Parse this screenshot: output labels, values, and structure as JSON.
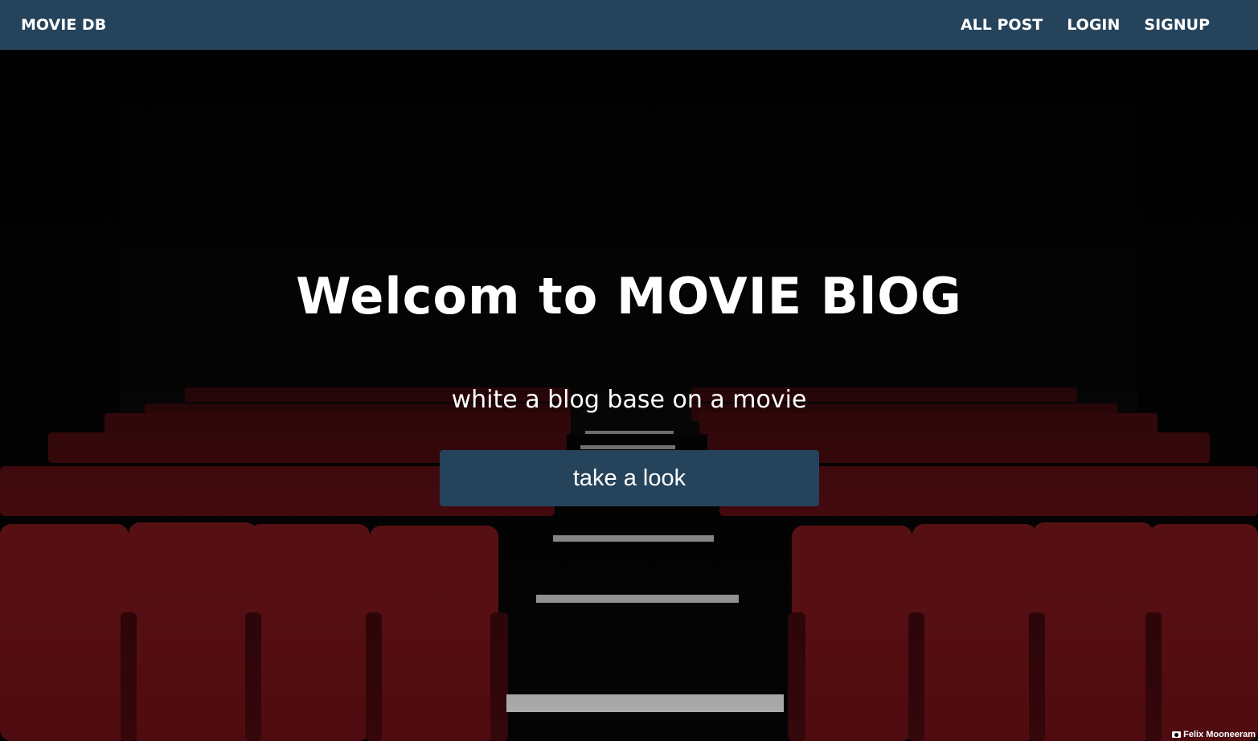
{
  "navbar": {
    "brand": "MOVIE DB",
    "links": [
      "ALL POST",
      "LOGIN",
      "SIGNUP"
    ]
  },
  "hero": {
    "title": "Welcom to MOVIE BlOG",
    "subtitle": "white a blog base on a movie",
    "cta_label": "take a look",
    "photo_credit": "Felix Mooneeram"
  },
  "colors": {
    "navbar_bg": "#25435b",
    "button_bg": "#25435b",
    "seat_red": "#7a1218",
    "text": "#ffffff"
  }
}
